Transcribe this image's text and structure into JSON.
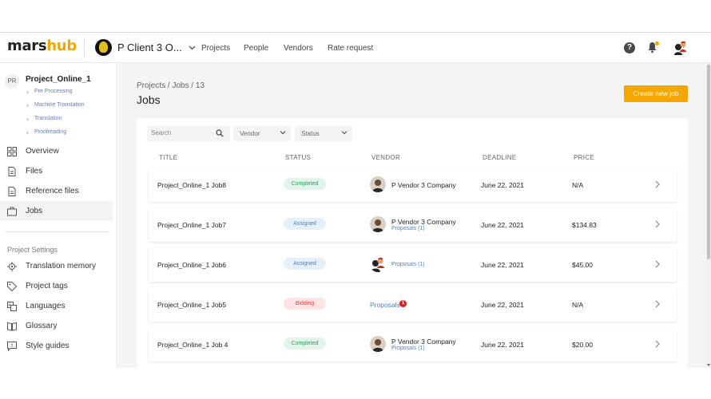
{
  "app": {
    "logo_part1": "mars",
    "logo_part2": "hub",
    "client_name": "P Client 3 O...",
    "nav": [
      "Projects",
      "People",
      "Vendors",
      "Rate request"
    ],
    "help_label": "?"
  },
  "sidebar": {
    "project_initials": "PR",
    "project_name": "Project_Online_1",
    "steps": [
      "Pre Processing",
      "Machine Translation",
      "Translation",
      "Proofreading"
    ],
    "items": [
      "Overview",
      "Files",
      "Reference files",
      "Jobs"
    ],
    "active_item": "Jobs",
    "settings_section": "Project Settings",
    "settings_items": [
      "Translation memory",
      "Project tags",
      "Languages",
      "Glossary",
      "Style guides"
    ]
  },
  "main": {
    "breadcrumb": "Projects / Jobs / 13",
    "title": "Jobs",
    "create_button": "Create new job",
    "search_placeholder": "Search",
    "filter_vendor": "Vendor",
    "filter_status": "Status",
    "columns": [
      "TITLE",
      "STATUS",
      "VENDOR",
      "DEADLINE",
      "PRICE"
    ],
    "rows": [
      {
        "title": "Project_Online_1 Job8",
        "status": "Completed",
        "vendor": "P Vendor 3 Company",
        "proposals": "",
        "deadline": "June 22, 2021",
        "price": "N/A"
      },
      {
        "title": "Project_Online_1 Job7",
        "status": "Assigned",
        "vendor": "P Vendor 3 Company",
        "proposals": "Proposals (1)",
        "deadline": "June 22, 2021",
        "price": "$134.83"
      },
      {
        "title": "Project_Online_1 Job6",
        "status": "Assigned",
        "vendor": "",
        "proposals": "Proposals (1)",
        "deadline": "June 22, 2021",
        "price": "$45.00"
      },
      {
        "title": "Project_Online_1 Job5",
        "status": "Bidding",
        "vendor": "",
        "proposals": "Proposals",
        "notif": "1",
        "deadline": "June 22, 2021",
        "price": "N/A"
      },
      {
        "title": "Project_Online_1 Job 4",
        "status": "Completed",
        "vendor": "P Vendor 3 Company",
        "proposals": "Proposals (1)",
        "deadline": "June 22, 2021",
        "price": "$20.00"
      }
    ]
  },
  "colors": {
    "accent": "#f5a500",
    "completed": "#2e9e63",
    "assigned": "#4c7fc0",
    "bidding": "#e04848"
  }
}
